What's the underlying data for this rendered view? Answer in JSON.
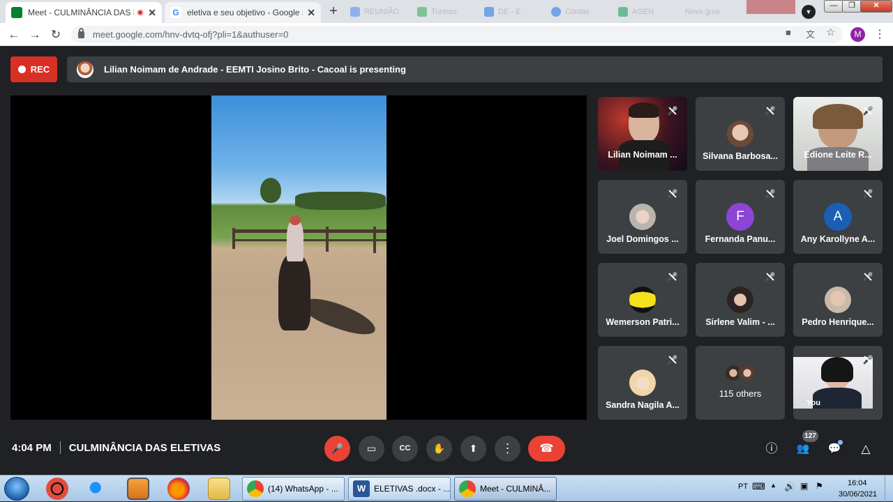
{
  "browser": {
    "tabs": [
      {
        "title": "Meet - CULMINÂNCIA DAS E",
        "close": "✕",
        "favicon_color": "#00832d"
      },
      {
        "title": "eletiva e seu objetivo - Google Sc",
        "close": "✕",
        "favicon_label": "G"
      }
    ],
    "ghost_tabs": [
      "REUNIÃO",
      "Turmas",
      "DE - E",
      "Contas",
      "AGEN",
      "Nova guia"
    ],
    "new_tab": "+",
    "url": "meet.google.com/hnv-dvtq-ofj?pli=1&authuser=0",
    "profile_letter": "M",
    "window_controls": {
      "minimize": "—",
      "maximize": "❐",
      "close": "✕"
    },
    "nav": {
      "back": "←",
      "forward": "→",
      "reload": "↻"
    },
    "omnibox_icons": {
      "camera": "■",
      "translate": "文",
      "star": "☆"
    }
  },
  "meet": {
    "rec_label": "REC",
    "presenting_text": "Lilian Noimam de Andrade - EEMTI Josino Brito - Cacoal is presenting",
    "participants": [
      {
        "name": "Lilian Noimam ...",
        "type": "video",
        "bg": "#3b1420"
      },
      {
        "name": "Silvana Barbosa...",
        "type": "photo",
        "color": "#6b4a3a"
      },
      {
        "name": "Edione Leite R...",
        "type": "video",
        "bg": "#cfd2cf"
      },
      {
        "name": "Joel Domingos ...",
        "type": "photo",
        "color": "#b9b5ad"
      },
      {
        "name": "Fernanda Panu...",
        "type": "letter",
        "letter": "F",
        "color": "#8e44d6"
      },
      {
        "name": "Any Karollyne A...",
        "type": "letter",
        "letter": "A",
        "color": "#1a5fb4"
      },
      {
        "name": "Wemerson Patri...",
        "type": "photo",
        "color": "#f2e21c"
      },
      {
        "name": "Sirlene Valim - ...",
        "type": "photo",
        "color": "#2b2422"
      },
      {
        "name": "Pedro Henrique...",
        "type": "photo",
        "color": "#c9b9a8"
      },
      {
        "name": "Sandra Nagila A...",
        "type": "photo",
        "color": "#f0d6a8"
      },
      {
        "name": "115 others",
        "type": "others"
      },
      {
        "name": "You",
        "type": "self",
        "bg": "#e8e8ea"
      }
    ],
    "meeting_time": "4:04 PM",
    "meeting_title": "CULMINÂNCIA DAS ELETIVAS",
    "participant_count": "127",
    "controls": {
      "mic": "🎤",
      "camera": "▭",
      "captions": "CC",
      "raise_hand": "✋",
      "present": "⬆",
      "more": "⋮",
      "hangup": "☎"
    },
    "right_controls": {
      "info": "ⓘ",
      "people": "👥",
      "chat": "💬",
      "activities": "△"
    }
  },
  "taskbar": {
    "tasks": [
      {
        "label": "(14) WhatsApp - ...",
        "icon_color": "#e8453c"
      },
      {
        "label": "ELETIVAS .docx - ...",
        "icon_color": "#2b579a"
      },
      {
        "label": "Meet - CULMINÂ...",
        "icon_color": "#e8453c"
      }
    ],
    "language": "PT",
    "time": "16:04",
    "date": "30/06/2021"
  }
}
